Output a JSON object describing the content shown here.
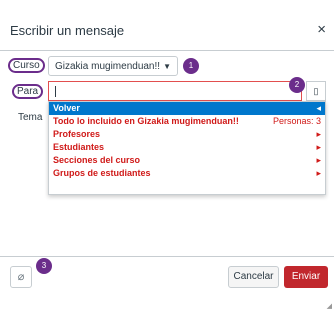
{
  "dialog": {
    "title": "Escribir un mensaje",
    "close_glyph": "×"
  },
  "course": {
    "label": "Curso",
    "value": "Gizakia mugimenduan!!",
    "badge": "1"
  },
  "to": {
    "label": "Para",
    "value": "",
    "badge": "2",
    "address_book_icon": "address-book-icon"
  },
  "subject": {
    "label": "Tema"
  },
  "dropdown": {
    "back_label": "Volver",
    "items": [
      {
        "label": "Todo lo incluido en Gizakia mugimenduan!!",
        "right": "Personas: 3"
      },
      {
        "label": "Profesores",
        "right": "▸"
      },
      {
        "label": "Estudiantes",
        "right": "▸"
      },
      {
        "label": "Secciones del curso",
        "right": "▸"
      },
      {
        "label": "Grupos de estudiantes",
        "right": "▸"
      }
    ],
    "back_arrow": "◂"
  },
  "footer": {
    "attach_badge": "3",
    "cancel_label": "Cancelar",
    "send_label": "Enviar"
  },
  "colors": {
    "accent_purple": "#6b2d8b",
    "send_red": "#c1272d",
    "highlight_blue": "#0077cc",
    "item_red": "#d01a19"
  }
}
